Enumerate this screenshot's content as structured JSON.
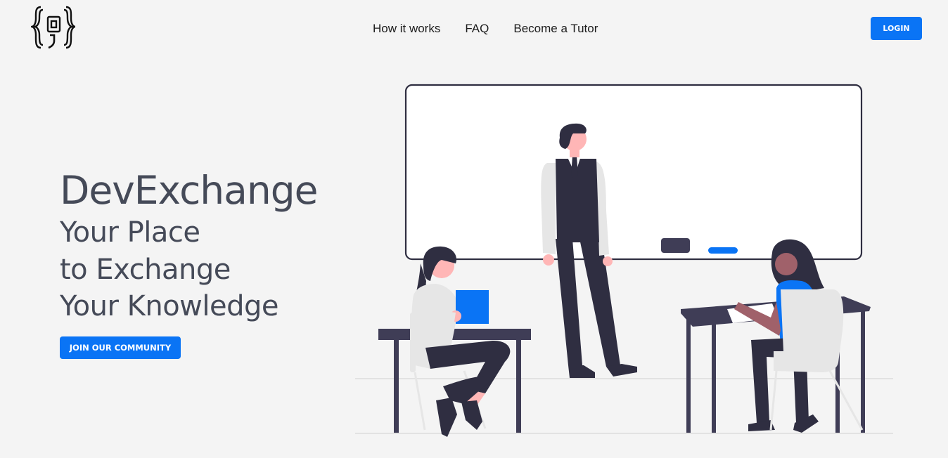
{
  "brand": {
    "logo_icon": "curly-braces-logo-icon"
  },
  "nav": {
    "items": [
      {
        "label": "How it works"
      },
      {
        "label": "FAQ"
      },
      {
        "label": "Become a Tutor"
      }
    ]
  },
  "header": {
    "login_label": "LOGIN"
  },
  "hero": {
    "title": "DevExchange",
    "subtitle_lines": [
      "Your Place",
      "to Exchange",
      "Your Knowledge"
    ],
    "cta_label": "JOIN OUR COMMUNITY"
  },
  "illustration": {
    "name": "classroom-illustration"
  },
  "colors": {
    "accent": "#0a74f5",
    "text": "#454a58",
    "background": "#f4f4f4",
    "dark": "#2f2e41",
    "skin": "#ffb6b6"
  }
}
